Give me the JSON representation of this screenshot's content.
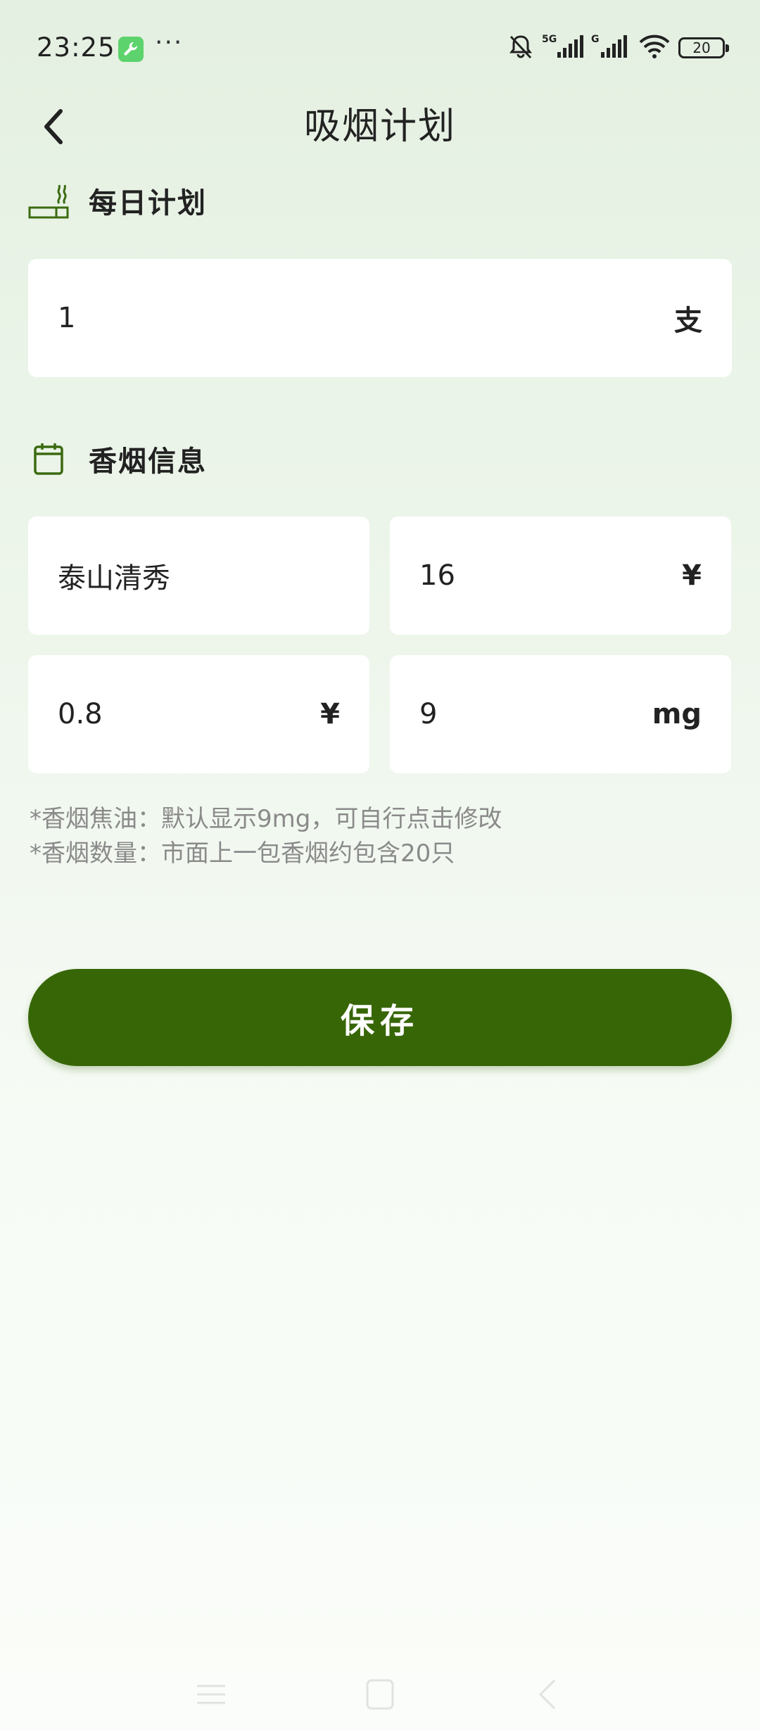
{
  "status_bar": {
    "time": "23:25",
    "dots": "···",
    "battery": "20",
    "icons": [
      "wrench-app-icon",
      "bell-muted-icon",
      "signal-5g-icon",
      "signal-g-icon",
      "wifi-icon",
      "battery-icon"
    ]
  },
  "header": {
    "title": "吸烟计划",
    "back_icon": "chevron-left-icon"
  },
  "daily_plan": {
    "title": "每日计划",
    "icon": "cigarette-icon",
    "value": "1",
    "unit": "支"
  },
  "cigarette_info": {
    "title": "香烟信息",
    "icon": "calendar-icon",
    "brand": "泰山清秀",
    "pack_price": "16",
    "pack_price_unit": "¥",
    "single_price": "0.8",
    "single_price_unit": "¥",
    "tar": "9",
    "tar_unit": "mg"
  },
  "notes": [
    "*香烟焦油：默认显示9mg，可自行点击修改",
    "*香烟数量：市面上一包香烟约包含20只"
  ],
  "save_label": "保存",
  "colors": {
    "primary": "#376606",
    "icon_green": "#3b6a10",
    "background_top": "#e4f0e1",
    "card": "#ffffff",
    "note_text": "#8a8a8a"
  },
  "nav_bar": {
    "icons": [
      "menu-icon",
      "home-square-icon",
      "back-triangle-icon"
    ]
  }
}
